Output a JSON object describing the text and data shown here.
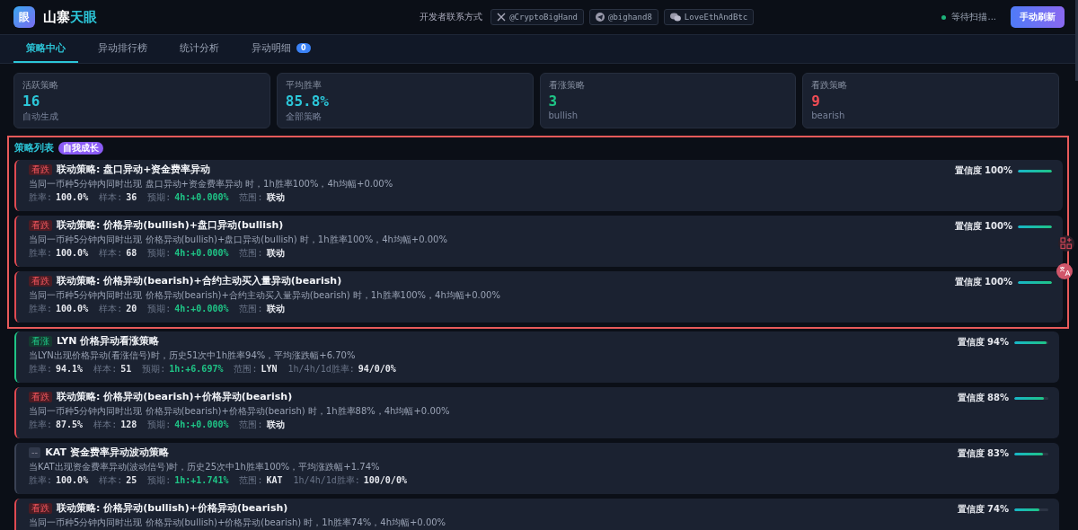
{
  "header": {
    "logo_char": "眼",
    "brand_main": "山寨",
    "brand_accent": "天眼",
    "contact_label": "开发者联系方式",
    "contacts": [
      {
        "kind": "x",
        "handle": "@CryptoBigHand"
      },
      {
        "kind": "telegram",
        "handle": "@bighand8"
      },
      {
        "kind": "wechat",
        "handle": "LoveEthAndBtc"
      }
    ],
    "status": "等待扫描...",
    "refresh_button": "手动刷新"
  },
  "tabs": [
    {
      "label": "策略中心",
      "selected": true
    },
    {
      "label": "异动排行榜",
      "selected": false
    },
    {
      "label": "统计分析",
      "selected": false
    },
    {
      "label": "异动明细",
      "selected": false,
      "badge": "0"
    }
  ],
  "stats": [
    {
      "label": "活跃策略",
      "value": "16",
      "sub": "自动生成",
      "color": "#2cc6d8"
    },
    {
      "label": "平均胜率",
      "value": "85.8%",
      "sub": "全部策略",
      "color": "#2cc6d8"
    },
    {
      "label": "看涨策略",
      "value": "3",
      "sub": "bullish",
      "color": "#1fc486"
    },
    {
      "label": "看跌策略",
      "value": "9",
      "sub": "bearish",
      "color": "#f04d55"
    }
  ],
  "strategy_list": {
    "title": "策略列表",
    "badge": "自我成长",
    "highlighted": true,
    "framed_items": [
      {
        "kind": "bearish",
        "tag": "看跌",
        "title": "联动策略: 盘口异动+资金费率异动",
        "desc": "当同一币种5分钟内同时出现 盘口异动+资金费率异动 时，1h胜率100%，4h均幅+0.00%",
        "meta": [
          {
            "label": "胜率:",
            "value": "100.0%",
            "kind": "plain"
          },
          {
            "label": "样本:",
            "value": "36",
            "kind": "plain"
          },
          {
            "label": "预期:",
            "value": "4h:+0.000%",
            "kind": "positive"
          },
          {
            "label": "范围:",
            "value": "联动",
            "kind": "plain"
          }
        ],
        "confidence": "置信度 100%",
        "level": 1
      },
      {
        "kind": "bearish",
        "tag": "看跌",
        "title": "联动策略: 价格异动(bullish)+盘口异动(bullish)",
        "desc": "当同一币种5分钟内同时出现 价格异动(bullish)+盘口异动(bullish) 时，1h胜率100%，4h均幅+0.00%",
        "meta": [
          {
            "label": "胜率:",
            "value": "100.0%",
            "kind": "plain"
          },
          {
            "label": "样本:",
            "value": "68",
            "kind": "plain"
          },
          {
            "label": "预期:",
            "value": "4h:+0.000%",
            "kind": "positive"
          },
          {
            "label": "范围:",
            "value": "联动",
            "kind": "plain"
          }
        ],
        "confidence": "置信度 100%",
        "level": 1
      },
      {
        "kind": "bearish",
        "tag": "看跌",
        "title": "联动策略: 价格异动(bearish)+合约主动买入量异动(bearish)",
        "desc": "当同一币种5分钟内同时出现 价格异动(bearish)+合约主动买入量异动(bearish) 时，1h胜率100%，4h均幅+0.00%",
        "meta": [
          {
            "label": "胜率:",
            "value": "100.0%",
            "kind": "plain"
          },
          {
            "label": "样本:",
            "value": "20",
            "kind": "plain"
          },
          {
            "label": "预期:",
            "value": "4h:+0.000%",
            "kind": "positive"
          },
          {
            "label": "范围:",
            "value": "联动",
            "kind": "plain"
          }
        ],
        "confidence": "置信度 100%",
        "level": 1
      }
    ],
    "items": [
      {
        "kind": "bullish",
        "tag": "看涨",
        "title": "LYN 价格异动看涨策略",
        "desc": "当LYN出现价格异动(看涨信号)时，历史51次中1h胜率94%，平均涨跌幅+6.70%",
        "meta": [
          {
            "label": "胜率:",
            "value": "94.1%",
            "kind": "plain"
          },
          {
            "label": "样本:",
            "value": "51",
            "kind": "plain"
          },
          {
            "label": "预期:",
            "value": "1h:+6.697%",
            "kind": "positive"
          },
          {
            "label": "范围:",
            "value": "LYN",
            "kind": "plain"
          },
          {
            "label": "1h/4h/1d胜率:",
            "value": "94/0/0%",
            "kind": "plain"
          }
        ],
        "confidence": "置信度 94%",
        "level": 0.94
      },
      {
        "kind": "bearish",
        "tag": "看跌",
        "title": "联动策略: 价格异动(bearish)+价格异动(bearish)",
        "desc": "当同一币种5分钟内同时出现 价格异动(bearish)+价格异动(bearish) 时，1h胜率88%，4h均幅+0.00%",
        "meta": [
          {
            "label": "胜率:",
            "value": "87.5%",
            "kind": "plain"
          },
          {
            "label": "样本:",
            "value": "128",
            "kind": "plain"
          },
          {
            "label": "预期:",
            "value": "4h:+0.000%",
            "kind": "positive"
          },
          {
            "label": "范围:",
            "value": "联动",
            "kind": "plain"
          }
        ],
        "confidence": "置信度 88%",
        "level": 0.88
      },
      {
        "kind": "neutral",
        "tag": "--",
        "title": "KAT 资金费率异动波动策略",
        "desc": "当KAT出现资金费率异动(波动信号)时，历史25次中1h胜率100%，平均涨跌幅+1.74%",
        "meta": [
          {
            "label": "胜率:",
            "value": "100.0%",
            "kind": "plain"
          },
          {
            "label": "样本:",
            "value": "25",
            "kind": "plain"
          },
          {
            "label": "预期:",
            "value": "1h:+1.741%",
            "kind": "positive"
          },
          {
            "label": "范围:",
            "value": "KAT",
            "kind": "plain"
          },
          {
            "label": "1h/4h/1d胜率:",
            "value": "100/0/0%",
            "kind": "plain"
          }
        ],
        "confidence": "置信度 83%",
        "level": 0.83
      },
      {
        "kind": "bearish",
        "tag": "看跌",
        "title": "联动策略: 价格异动(bullish)+价格异动(bearish)",
        "desc": "当同一币种5分钟内同时出现 价格异动(bullish)+价格异动(bearish) 时，1h胜率74%，4h均幅+0.00%",
        "confidence": "置信度 74%",
        "level": 0.74
      }
    ]
  }
}
